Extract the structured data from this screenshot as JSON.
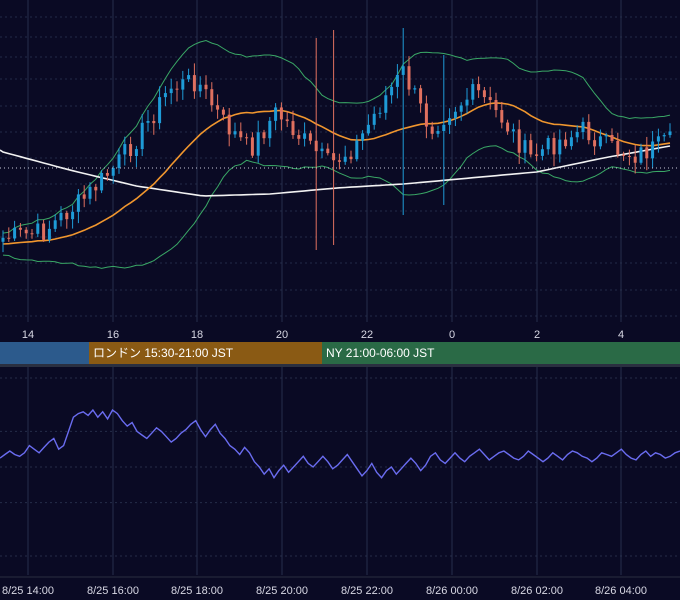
{
  "colors": {
    "background": "#0a0a24",
    "grid": "#2a3350",
    "candle_up": "#1e9bd7",
    "candle_down": "#e0705f",
    "bollinger": "#3aa866",
    "ma_short": "#f0962e",
    "ma_long": "#f2f2f2",
    "oscillator": "#6a6cf0",
    "session_tokyo": "#2c5a8c",
    "session_london": "#8a5a14",
    "session_ny": "#2a6a46"
  },
  "sessions": [
    {
      "label": "",
      "color_key": "session_tokyo"
    },
    {
      "label": "ロンドン 15:30-21:00 JST",
      "color_key": "session_london"
    },
    {
      "label": "NY 21:00-06:00 JST",
      "color_key": "session_ny"
    }
  ],
  "chart_data": [
    {
      "type": "candlestick",
      "title": "",
      "x_tick_labels": [
        "14",
        "16",
        "18",
        "20",
        "22",
        "0",
        "2",
        "4"
      ],
      "x_range_hours": [
        13.2,
        5.3
      ],
      "bar_interval_minutes": 10,
      "series": [
        {
          "name": "",
          "kind": "bollinger_bands",
          "color_key": "bollinger"
        },
        {
          "name": "",
          "kind": "moving_average_short",
          "color_key": "ma_short"
        },
        {
          "name": "",
          "kind": "moving_average_long",
          "color_key": "ma_long"
        }
      ],
      "grid": true
    },
    {
      "type": "line",
      "title": "",
      "x_tick_labels": [
        "8/25 14:00",
        "8/25 16:00",
        "8/25 18:00",
        "8/25 20:00",
        "8/25 22:00",
        "8/26 00:00",
        "8/26 02:00",
        "8/26 04:00"
      ],
      "y_range": [
        0,
        100
      ],
      "values": [
        55,
        57,
        59,
        57,
        56,
        58,
        62,
        60,
        58,
        61,
        64,
        66,
        60,
        62,
        70,
        78,
        80,
        81,
        79,
        82,
        78,
        81,
        77,
        82,
        80,
        76,
        73,
        75,
        70,
        68,
        66,
        69,
        72,
        70,
        67,
        64,
        66,
        69,
        71,
        74,
        76,
        71,
        67,
        71,
        74,
        69,
        66,
        62,
        60,
        57,
        61,
        58,
        53,
        50,
        46,
        49,
        44,
        48,
        51,
        47,
        50,
        53,
        56,
        52,
        50,
        53,
        56,
        53,
        49,
        51,
        54,
        57,
        53,
        49,
        45,
        48,
        52,
        47,
        44,
        48,
        50,
        46,
        49,
        52,
        55,
        52,
        48,
        51,
        56,
        58,
        54,
        52,
        55,
        58,
        55,
        53,
        56,
        58,
        60,
        57,
        54,
        56,
        58,
        59,
        57,
        55,
        54,
        56,
        59,
        57,
        55,
        53,
        55,
        58,
        56,
        54,
        57,
        59,
        58,
        56,
        55,
        53,
        55,
        58,
        57,
        56,
        58,
        60,
        57,
        55,
        54,
        57,
        59,
        56,
        58,
        57,
        55,
        56,
        58,
        59
      ],
      "levels": [
        70,
        50,
        30
      ],
      "series": [
        {
          "name": "",
          "color_key": "oscillator"
        }
      ],
      "grid": true
    }
  ]
}
